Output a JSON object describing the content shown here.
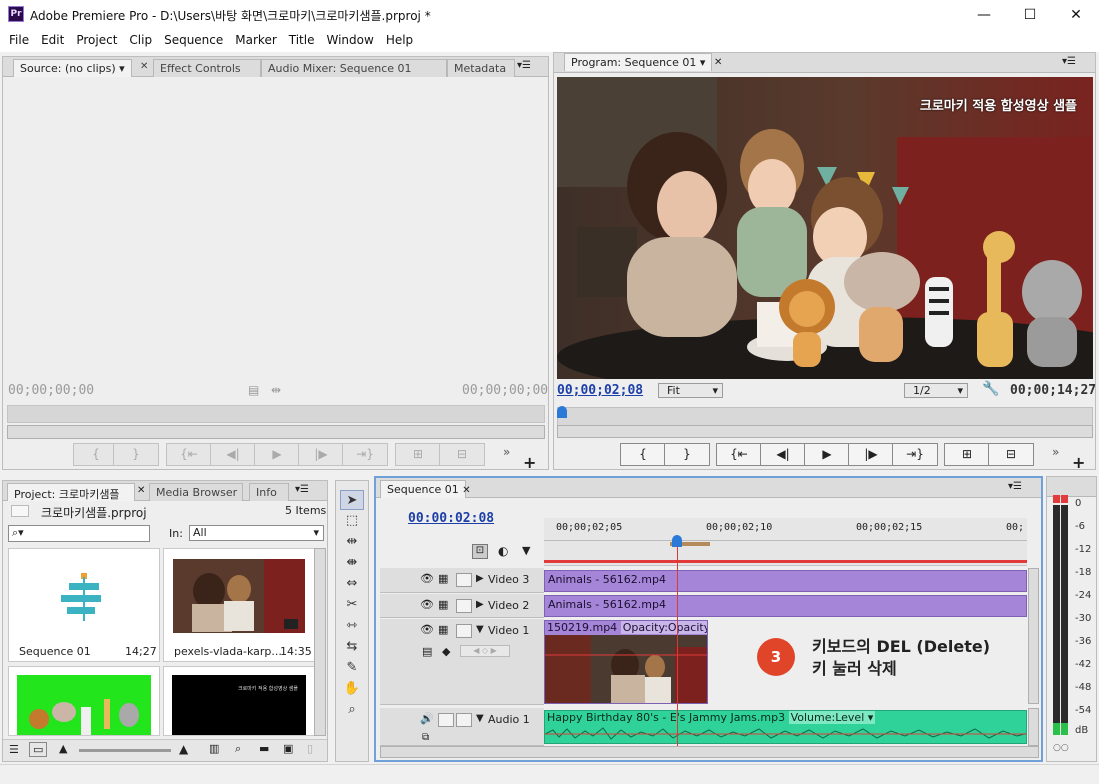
{
  "app": {
    "title": "Adobe Premiere Pro - D:\\Users\\바탕 화면\\크로마키\\크로마키샘플.prproj *",
    "icon": "Pr"
  },
  "window_controls": {
    "minimize": "—",
    "maximize": "☐",
    "close": "✕"
  },
  "menu": [
    "File",
    "Edit",
    "Project",
    "Clip",
    "Sequence",
    "Marker",
    "Title",
    "Window",
    "Help"
  ],
  "source_panel": {
    "tabs": [
      "Source: (no clips)",
      "Effect Controls",
      "Audio Mixer: Sequence 01",
      "Metadata"
    ],
    "timecode_left": "00;00;00;00",
    "timecode_right": "00;00;00;00"
  },
  "program_panel": {
    "tab": "Program: Sequence 01",
    "overlay_text": "크로마키 적용 합성영상 샘플",
    "timecode_current": "00;00;02;08",
    "zoom": "Fit",
    "resolution": "1/2",
    "timecode_duration": "00;00;14;27"
  },
  "project_panel": {
    "tabs": [
      "Project: 크로마키샘플",
      "Media Browser",
      "Info"
    ],
    "file_name": "크로마키샘플.prproj",
    "item_count": "5 Items",
    "search_placeholder": "",
    "in_label": "In:",
    "in_value": "All",
    "items": [
      {
        "name": "Sequence 01",
        "duration": "14;27"
      },
      {
        "name": "pexels-vlada-karp...",
        "duration": "14:35"
      }
    ],
    "black_thumb_text": "크로마키 적용 합성영상 샘플"
  },
  "timeline": {
    "tab": "Sequence 01",
    "timecode": "00:00:02:08",
    "ruler": [
      "00;00;02;05",
      "00;00;02;10",
      "00;00;02;15",
      "00;"
    ],
    "tracks": [
      {
        "name": "Video 3",
        "clip": "Animals - 56162.mp4"
      },
      {
        "name": "Video 2",
        "clip": "Animals - 56162.mp4"
      },
      {
        "name": "Video 1",
        "clip": "150219.mp4",
        "effect": "Opacity:Opacity"
      },
      {
        "name": "Audio 1",
        "clip": "Happy Birthday 80's - E's Jammy Jams.mp3",
        "effect": "Volume:Level"
      }
    ]
  },
  "callout": {
    "number": "3",
    "line1": "키보드의 DEL (Delete)",
    "line2": "키 눌러 삭제"
  },
  "meter": {
    "labels": [
      "0",
      "-6",
      "-12",
      "-18",
      "-24",
      "-30",
      "-36",
      "-42",
      "-48",
      "-54",
      "dB"
    ]
  },
  "colors": {
    "clip_video": "#a585d8",
    "clip_audio": "#2fd39a",
    "callout": "#e0452a",
    "timecode_blue": "#1d3fa8"
  }
}
